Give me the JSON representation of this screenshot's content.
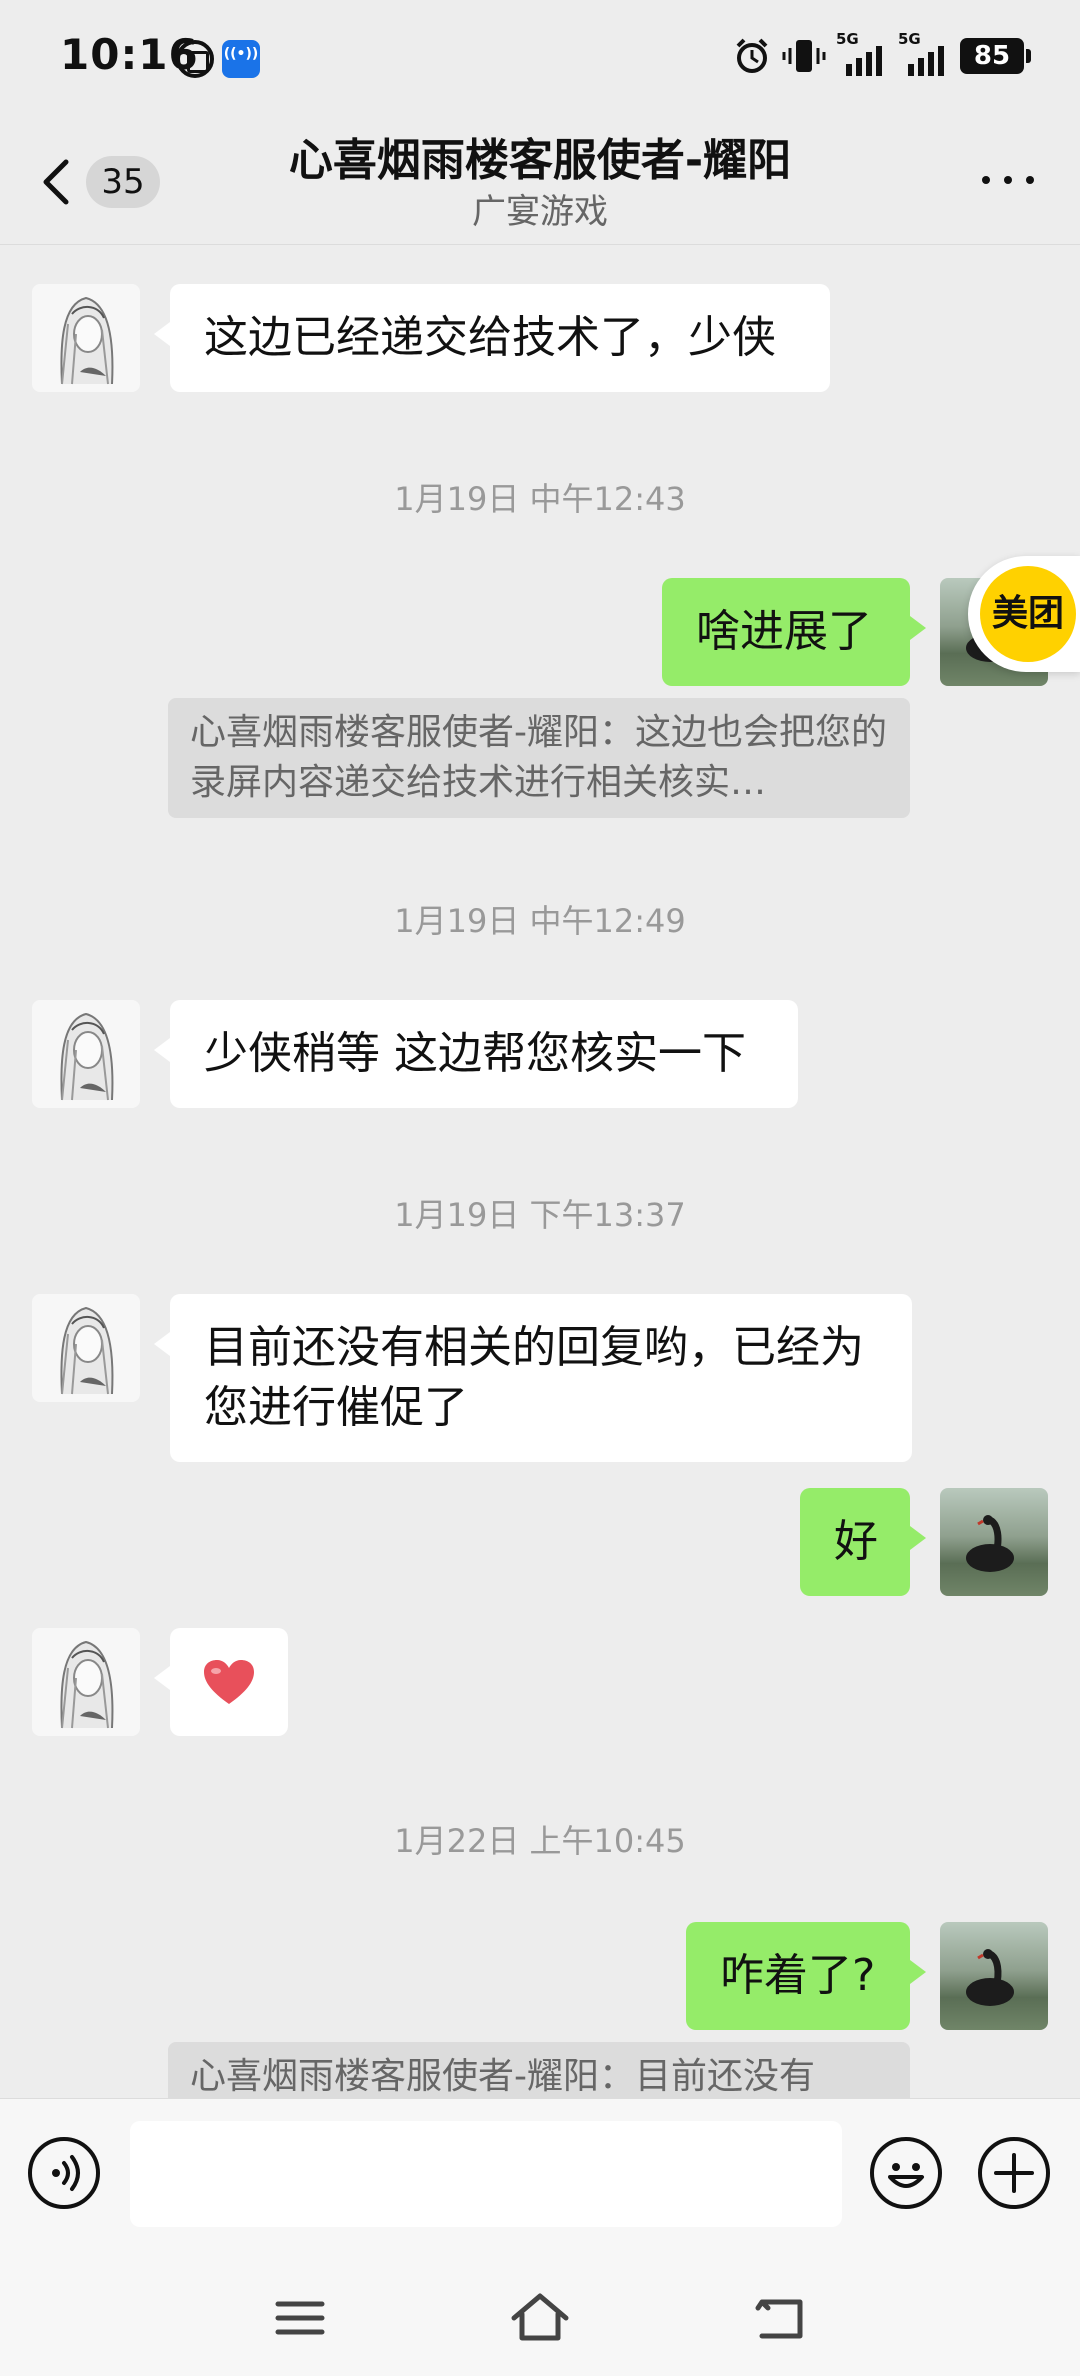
{
  "status_bar": {
    "time": "10:16",
    "network_1": "5G",
    "network_2": "5G",
    "battery": "85"
  },
  "header": {
    "unread_count": "35",
    "title": "心喜烟雨楼客服使者-耀阳",
    "subtitle": "广宴游戏"
  },
  "messages": [
    {
      "text": "这边已经递交给技术了，少侠"
    },
    {
      "timestamp": "1月19日 中午12:43"
    },
    {
      "text": "啥进展了"
    },
    {
      "quote": "心喜烟雨楼客服使者-耀阳：这边也会把您的录屏内容递交给技术进行相关核实…"
    },
    {
      "timestamp": "1月19日 中午12:49"
    },
    {
      "text": "少侠稍等 这边帮您核实一下"
    },
    {
      "timestamp": "1月19日 下午13:37"
    },
    {
      "text": "目前还没有相关的回复哟，已经为您进行催促了"
    },
    {
      "text": "好"
    },
    {
      "emoji": "heart"
    },
    {
      "timestamp": "1月22日 上午10:45"
    },
    {
      "text": "咋着了?"
    },
    {
      "quote": "心喜烟雨楼客服使者-耀阳：目前还没有"
    }
  ],
  "floating_badge": {
    "label": "美团"
  },
  "colors": {
    "background": "#ededed",
    "bubble_in": "#ffffff",
    "bubble_out": "#95ec69",
    "badge_yellow": "#ffd100"
  },
  "icons": {
    "back": "chevron-left-icon",
    "more": "more-dots-icon",
    "voice": "voice-icon",
    "emoji": "emoji-icon",
    "plus": "plus-icon"
  }
}
